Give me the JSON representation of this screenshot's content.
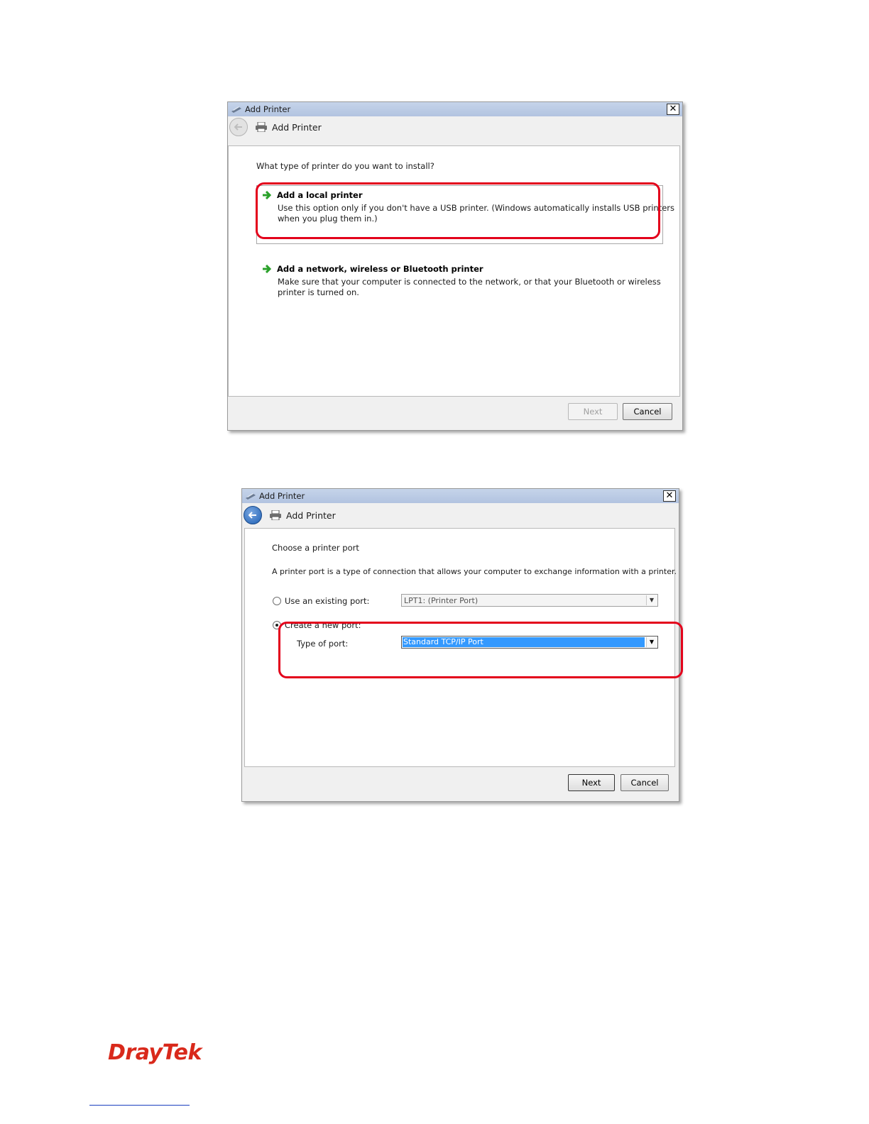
{
  "dialog1": {
    "window_title": "Add Printer",
    "nav_title": "Add Printer",
    "question": "What type of printer do you want to install?",
    "options": [
      {
        "title": "Add a local printer",
        "desc_line1": "Use this option only if you don't have a USB printer. (Windows automatically installs USB printers",
        "desc_line2": "when you plug them in.)"
      },
      {
        "title": "Add a network, wireless or Bluetooth printer",
        "desc_line1": "Make sure that your computer is connected to the network, or that your Bluetooth or wireless",
        "desc_line2": "printer is turned on."
      }
    ],
    "next_label": "Next",
    "cancel_label": "Cancel"
  },
  "dialog2": {
    "window_title": "Add Printer",
    "nav_title": "Add Printer",
    "heading": "Choose a printer port",
    "description": "A printer port is a type of connection that allows your computer to exchange information with a printer.",
    "existing_port_label": "Use an existing port:",
    "existing_port_value": "LPT1: (Printer Port)",
    "new_port_label": "Create a new port:",
    "type_of_port_label": "Type of port:",
    "type_of_port_value": "Standard TCP/IP Port",
    "next_label": "Next",
    "cancel_label": "Cancel"
  },
  "footer": {
    "logo_text": "DrayTek"
  },
  "colors": {
    "highlight": "#e3001b",
    "titlebar": "#b8c8e4",
    "selection": "#3399ff",
    "logo": "#d9291b"
  }
}
